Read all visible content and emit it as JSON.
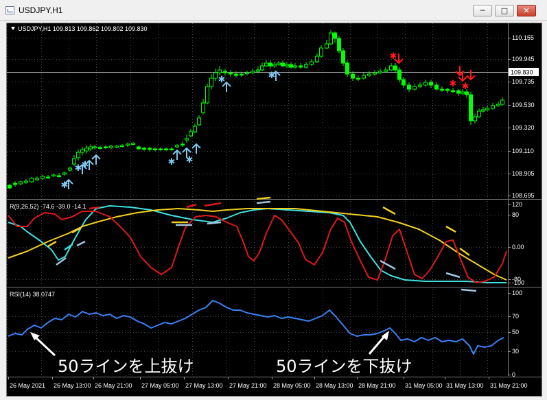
{
  "window": {
    "title": "USDJPY,H1",
    "buttons": {
      "minimize": "─",
      "maximize": "□",
      "close": "✕"
    }
  },
  "main": {
    "header": "USDJPY,H1  109.813 109.862 109.802 109.830",
    "price_ticks": [
      "110.155",
      "109.945",
      "109.735",
      "109.530",
      "109.320",
      "109.110",
      "108.905",
      "108.695"
    ],
    "current_price": "109.830",
    "candle_color": "#00ff00",
    "up_arrow_color": "#7ec8f0",
    "down_arrow_color": "#ff1a1a"
  },
  "rci": {
    "header": "R(9,26,52) -74.6 -39.0 -14.1",
    "ticks": [
      "120",
      "80",
      "0.00",
      "-80",
      "-100"
    ]
  },
  "rsi": {
    "header": "RSI(14) 38.0747",
    "ticks": [
      "100",
      "70",
      "50",
      "30",
      "0"
    ]
  },
  "time_axis": [
    "26 May 2021",
    "26 May 13:00",
    "26 May 21:00",
    "27 May 05:00",
    "27 May 13:00",
    "27 May 21:00",
    "28 May 05:00",
    "28 May 13:00",
    "28 May 21:00",
    "31 May 05:00",
    "31 May 13:00",
    "31 May 21:00"
  ],
  "annotations": {
    "left": "50ラインを上抜け",
    "right": "50ラインを下抜け"
  }
}
